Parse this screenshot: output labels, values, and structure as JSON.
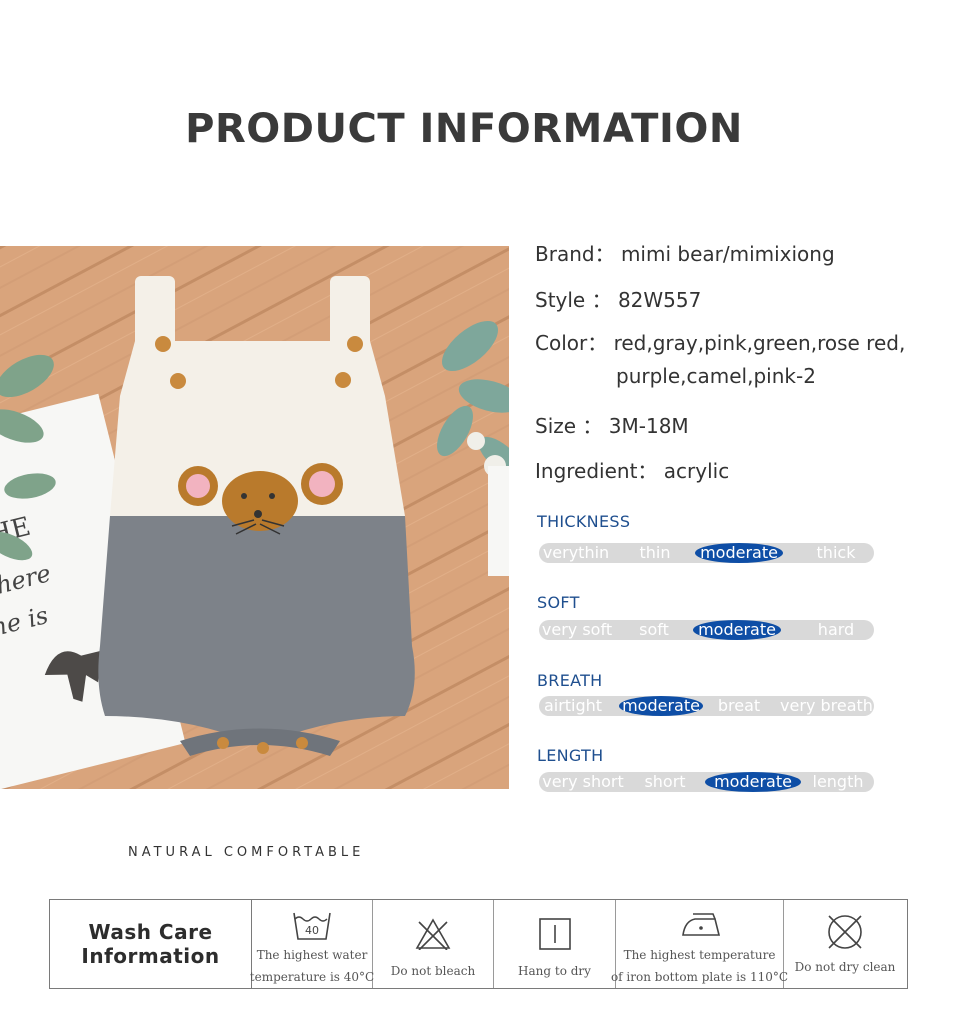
{
  "title": "PRODUCT INFORMATION",
  "specs": [
    {
      "label": "Brand：",
      "value": "mimi bear/mimixiong"
    },
    {
      "label": "Style ：",
      "value": "82W557"
    },
    {
      "label": "Color：",
      "value": "red,gray,pink,green,rose red,",
      "value2": "purple,camel,pink-2"
    },
    {
      "label": "Size  ：",
      "value": "3M-18M"
    },
    {
      "label": "Ingredient：",
      "value": "acrylic"
    }
  ],
  "meters": [
    {
      "title": "THICKNESS",
      "options": [
        "verythin",
        "thin",
        "moderate",
        "thick"
      ],
      "selected": "moderate"
    },
    {
      "title": "SOFT",
      "options": [
        "very soft",
        "soft",
        "moderate",
        "hard"
      ],
      "selected": "moderate"
    },
    {
      "title": "BREATH",
      "options": [
        "airtight",
        "moderate",
        "breat",
        "very breath"
      ],
      "selected": "moderate"
    },
    {
      "title": "LENGTH",
      "options": [
        "very short",
        "short",
        "moderate",
        "length"
      ],
      "selected": "moderate"
    }
  ],
  "photo": {
    "card_text": [
      "HE",
      "Where",
      "he is"
    ]
  },
  "natural_label": "NATURAL COMFORTABLE",
  "care": {
    "heading_line1": "Wash Care",
    "heading_line2": "Information",
    "items": [
      {
        "icon": "wash-40-icon",
        "number": "40",
        "line1": "The highest water",
        "line2": "temperature is 40°C"
      },
      {
        "icon": "no-bleach-icon",
        "line1": "Do not bleach",
        "line2": ""
      },
      {
        "icon": "hang-dry-icon",
        "line1": "Hang to dry",
        "line2": ""
      },
      {
        "icon": "iron-icon",
        "line1": "The highest temperature",
        "line2": "of iron bottom plate is 110°C"
      },
      {
        "icon": "no-dry-clean-icon",
        "line1": "Do not dry clean",
        "line2": ""
      }
    ]
  },
  "colors": {
    "meter_track": "#d9d9d9",
    "meter_selected": "#0e4ea6",
    "meter_title": "#1f4f8f",
    "wood": "#d9a47c",
    "romper_white": "#f4f0e8",
    "romper_gray": "#7d8289",
    "mouse_brown": "#b97a2c",
    "ear_pink": "#f2b3c0",
    "button_wood": "#c98a3e"
  }
}
